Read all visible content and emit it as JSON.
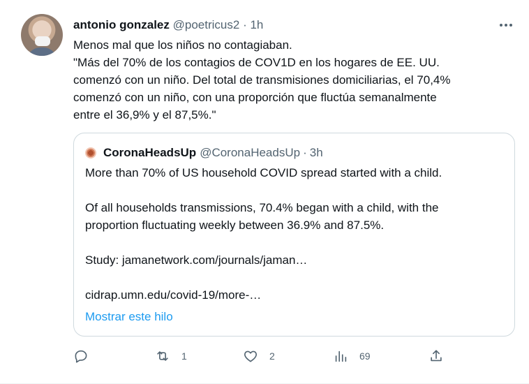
{
  "tweet": {
    "display_name": "antonio gonzalez",
    "handle": "@poetricus2",
    "separator": "·",
    "time": "1h",
    "text_lines": [
      "Menos mal que los niños no contagiaban.",
      "\"Más del 70% de los contagios de COV1D en los hogares de EE. UU.",
      "comenzó con un niño. Del total de transmisiones domiciliarias, el 70,4%",
      "comenzó con un niño, con una proporción que fluctúa semanalmente",
      "entre el 36,9% y el 87,5%.\""
    ]
  },
  "quote": {
    "display_name": "CoronaHeadsUp",
    "handle": "@CoronaHeadsUp",
    "separator": "·",
    "time": "3h",
    "text_lines": [
      "More than 70% of US household COVID spread started with a child.",
      "",
      "Of all households transmissions, 70.4% began with a child, with the",
      "proportion fluctuating weekly between 36.9% and 87.5%.",
      "",
      "Study: jamanetwork.com/journals/jaman…",
      "",
      "cidrap.umn.edu/covid-19/more-…"
    ],
    "show_thread": "Mostrar este hilo"
  },
  "actions": {
    "reply": {
      "icon": "reply-icon",
      "count": ""
    },
    "retweet": {
      "icon": "retweet-icon",
      "count": "1"
    },
    "like": {
      "icon": "heart-icon",
      "count": "2"
    },
    "views": {
      "icon": "views-icon",
      "count": "69"
    },
    "share": {
      "icon": "share-icon",
      "count": ""
    }
  },
  "colors": {
    "text": "#0f1419",
    "secondary": "#536471",
    "link": "#1d9bf0",
    "border": "#cfd9de"
  }
}
